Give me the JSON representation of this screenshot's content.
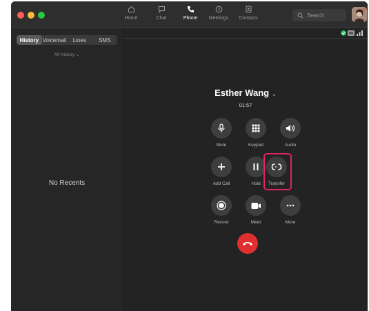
{
  "nav": [
    {
      "label": "Home",
      "icon": "home-icon"
    },
    {
      "label": "Chat",
      "icon": "chat-icon"
    },
    {
      "label": "Phone",
      "icon": "phone-icon",
      "active": true
    },
    {
      "label": "Meetings",
      "icon": "clock-icon"
    },
    {
      "label": "Contacts",
      "icon": "contacts-icon"
    }
  ],
  "search": {
    "placeholder": "Search"
  },
  "sidebar": {
    "tabs": [
      "History",
      "Voicemail",
      "Lines",
      "SMS"
    ],
    "selected_tab": "History",
    "filter": "All History",
    "empty_text": "No Recents"
  },
  "call": {
    "caller": "Esther Wang",
    "duration": "01:57",
    "controls": [
      {
        "label": "Mute",
        "icon": "microphone-icon"
      },
      {
        "label": "Keypad",
        "icon": "keypad-icon"
      },
      {
        "label": "Audio",
        "icon": "speaker-icon"
      },
      {
        "label": "Add Call",
        "icon": "plus-icon"
      },
      {
        "label": "Hold",
        "icon": "pause-icon"
      },
      {
        "label": "Transfer",
        "icon": "transfer-icon",
        "highlighted": true
      },
      {
        "label": "Record",
        "icon": "record-icon"
      },
      {
        "label": "Meet",
        "icon": "video-camera-icon"
      },
      {
        "label": "More",
        "icon": "more-icon"
      }
    ]
  },
  "colors": {
    "accent_highlight": "#e0245e",
    "end_call": "#e02f2f",
    "secure_badge": "#2ecc71"
  }
}
